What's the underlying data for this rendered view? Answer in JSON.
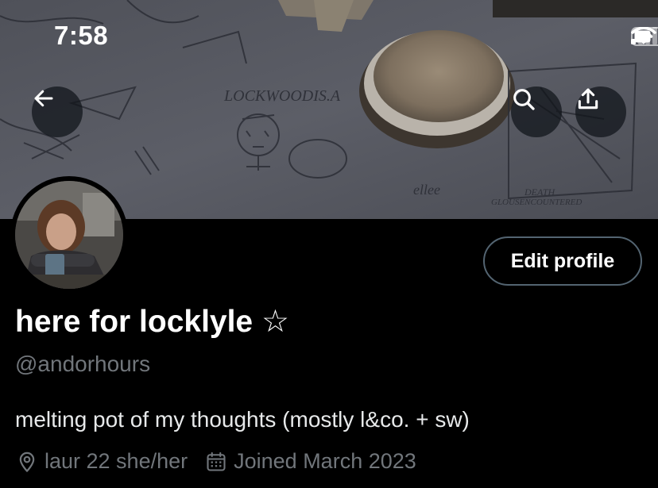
{
  "status_bar": {
    "time": "7:58"
  },
  "icons": {
    "back": "arrow-left-icon",
    "search": "search-icon",
    "share": "share-upload-icon",
    "signal": "cellular-signal-icon",
    "wifi": "wifi-icon",
    "battery": "battery-icon",
    "location": "location-pin-icon",
    "calendar": "calendar-icon"
  },
  "banner_text": {
    "line1": "LOCKWOODIS.A",
    "line2": "DEATH",
    "line3": "GLOUSENCOUNTERED",
    "doodle": "ellee"
  },
  "profile": {
    "display_name": "here for locklyle ☆",
    "handle": "@andorhours",
    "bio": "melting pot of my thoughts (mostly l&co. + sw)",
    "location": "laur 22 she/her",
    "joined": "Joined March 2023",
    "edit_label": "Edit profile"
  },
  "colors": {
    "background": "#000000",
    "primary_text": "#e7e9ea",
    "secondary_text": "#71767b",
    "button_border": "#536471"
  }
}
